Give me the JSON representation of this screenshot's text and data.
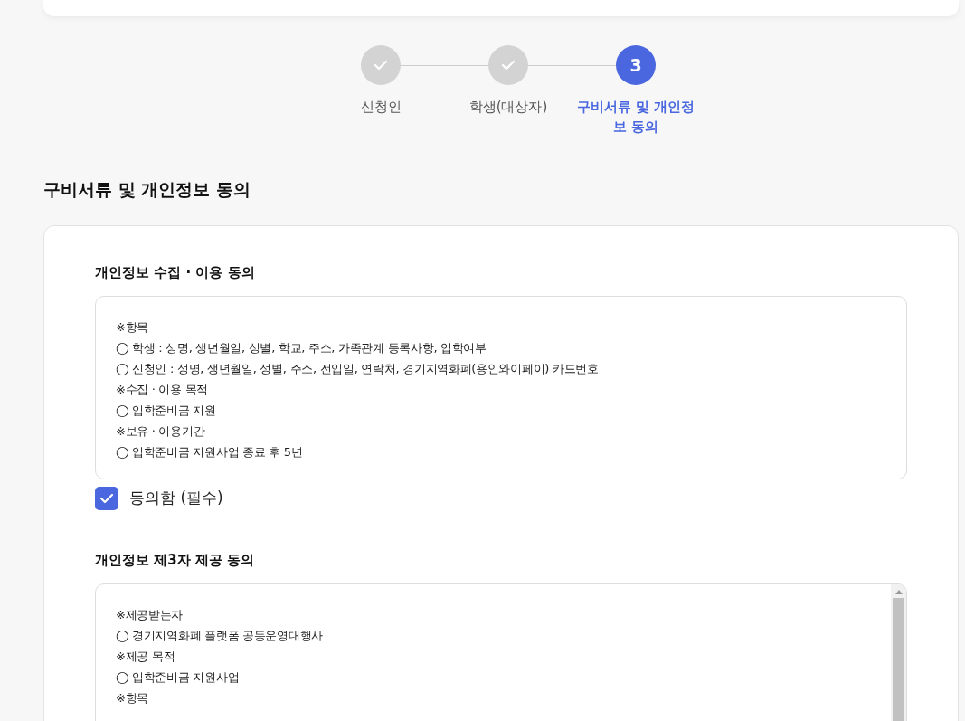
{
  "steps": [
    {
      "label": "신청인",
      "completed": true,
      "selected": false
    },
    {
      "label": "학생(대상자)",
      "completed": true,
      "selected": false
    },
    {
      "label": "구비서류 및 개인정보 동의",
      "number": "3",
      "completed": false,
      "selected": true
    }
  ],
  "page_title": "구비서류 및 개인정보 동의",
  "sections": [
    {
      "title": "개인정보 수집 · 이용 동의",
      "scrollable": false,
      "lines": [
        "※항목",
        "◯ 학생 : 성명, 생년월일, 성별, 학교, 주소, 가족관계 등록사항, 입학여부",
        "◯ 신청인 : 성명, 생년월일, 성별, 주소, 전입일, 연락처, 경기지역화폐(용인와이페이) 카드번호",
        "※수집 · 이용 목적",
        "◯ 입학준비금 지원",
        "※보유 · 이용기간",
        "◯ 입학준비금 지원사업 종료 후 5년"
      ],
      "consent": {
        "label": "동의함 (필수)",
        "checked": true
      }
    },
    {
      "title": "개인정보 제3자 제공 동의",
      "scrollable": true,
      "lines": [
        "※제공받는자",
        "◯ 경기지역화폐 플랫폼 공동운영대행사",
        "※제공 목적",
        "◯ 입학준비금 지원사업",
        "※항목"
      ]
    }
  ]
}
